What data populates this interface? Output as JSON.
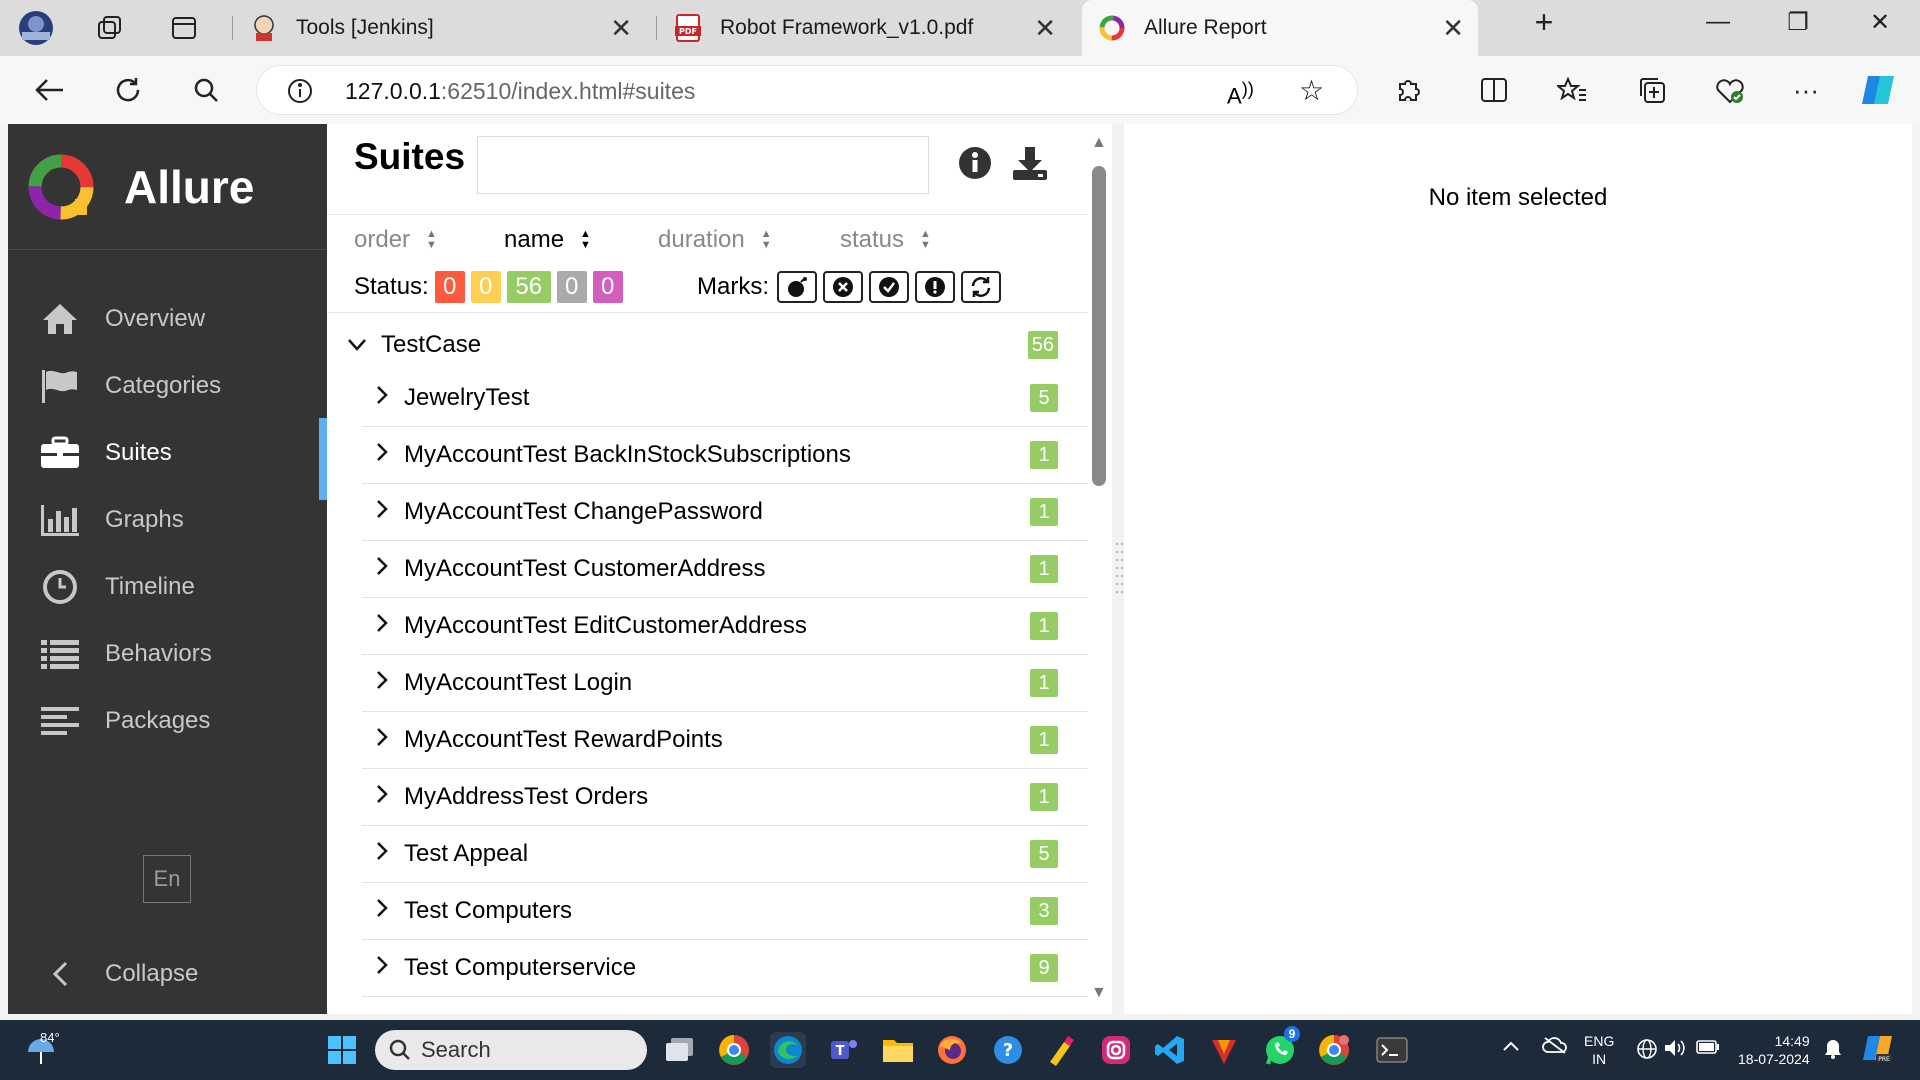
{
  "browser": {
    "tabs": [
      {
        "title": "Tools [Jenkins]"
      },
      {
        "title": "Robot Framework_v1.0.pdf"
      },
      {
        "title": "Allure Report"
      }
    ],
    "url_host": "127.0.0.1",
    "url_rest": ":62510/index.html#suites"
  },
  "sidebar": {
    "brand": "Allure",
    "items": [
      {
        "label": "Overview",
        "icon": "home-icon"
      },
      {
        "label": "Categories",
        "icon": "flag-icon"
      },
      {
        "label": "Suites",
        "icon": "briefcase-icon",
        "active": true
      },
      {
        "label": "Graphs",
        "icon": "bar-chart-icon"
      },
      {
        "label": "Timeline",
        "icon": "clock-icon"
      },
      {
        "label": "Behaviors",
        "icon": "list-icon"
      },
      {
        "label": "Packages",
        "icon": "align-left-icon"
      }
    ],
    "language": "En",
    "collapse": "Collapse"
  },
  "suites": {
    "title": "Suites",
    "sort": {
      "order": "order",
      "name": "name",
      "duration": "duration",
      "status": "status"
    },
    "status_label": "Status:",
    "status_counts": [
      {
        "value": "0",
        "color": "#fd5a3e"
      },
      {
        "value": "0",
        "color": "#ffd050"
      },
      {
        "value": "56",
        "color": "#97cc64"
      },
      {
        "value": "0",
        "color": "#aaaaaa"
      },
      {
        "value": "0",
        "color": "#d35ebe"
      }
    ],
    "marks_label": "Marks:",
    "group": {
      "name": "TestCase",
      "count": "56"
    },
    "rows": [
      {
        "name": "JewelryTest",
        "count": "5"
      },
      {
        "name": "MyAccountTest BackInStockSubscriptions",
        "count": "1"
      },
      {
        "name": "MyAccountTest ChangePassword",
        "count": "1"
      },
      {
        "name": "MyAccountTest CustomerAddress",
        "count": "1"
      },
      {
        "name": "MyAccountTest EditCustomerAddress",
        "count": "1"
      },
      {
        "name": "MyAccountTest Login",
        "count": "1"
      },
      {
        "name": "MyAccountTest RewardPoints",
        "count": "1"
      },
      {
        "name": "MyAddressTest Orders",
        "count": "1"
      },
      {
        "name": "Test Appeal",
        "count": "5"
      },
      {
        "name": "Test Computers",
        "count": "3"
      },
      {
        "name": "Test Computerservice",
        "count": "9"
      }
    ]
  },
  "detail": {
    "empty": "No item selected"
  },
  "taskbar": {
    "weather": "84°",
    "search_placeholder": "Search",
    "whatsapp_badge": "9",
    "lang_top": "ENG",
    "lang_bottom": "IN",
    "time": "14:49",
    "date": "18-07-2024"
  }
}
